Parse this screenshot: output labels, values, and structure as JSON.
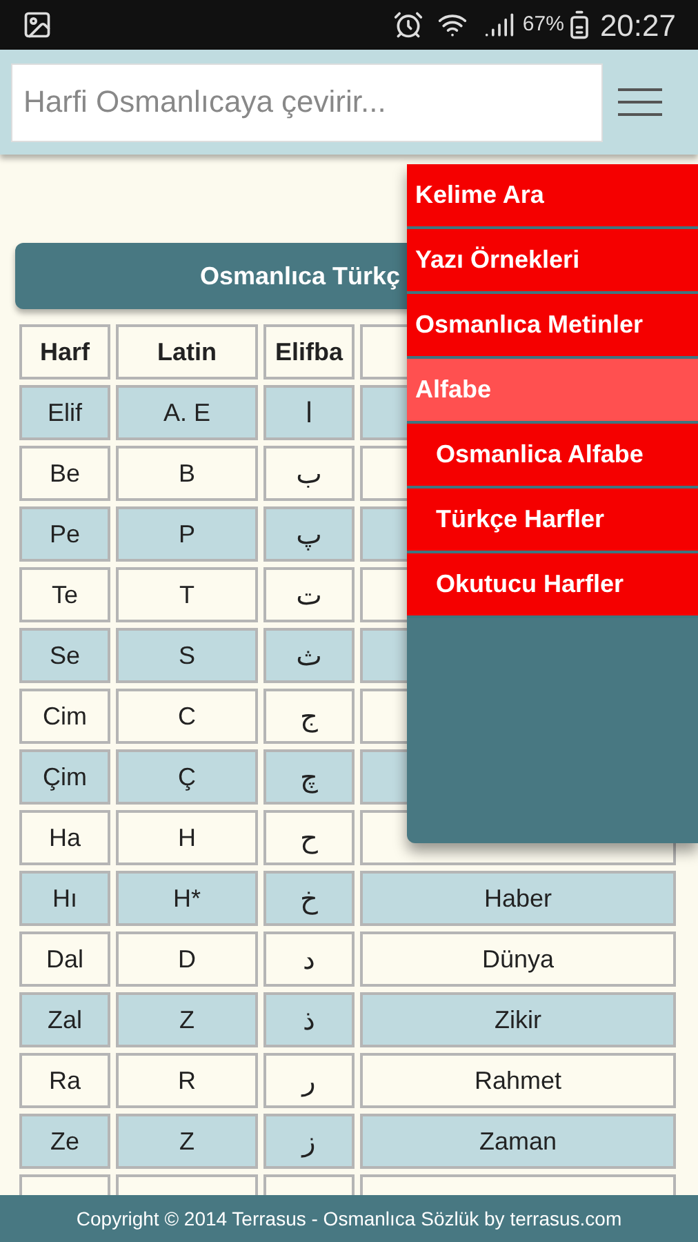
{
  "status_bar": {
    "battery": "67%",
    "time": "20:27"
  },
  "search": {
    "placeholder": "Harfi Osmanlıcaya çevirir..."
  },
  "title": "Osmanlıca Türkç",
  "table": {
    "columns": [
      "Harf",
      "Latin",
      "Elifba"
    ],
    "rows": [
      {
        "harf": "Elif",
        "latin": "A. E",
        "elifba": "ا"
      },
      {
        "harf": "Be",
        "latin": "B",
        "elifba": "ب"
      },
      {
        "harf": "Pe",
        "latin": "P",
        "elifba": "پ"
      },
      {
        "harf": "Te",
        "latin": "T",
        "elifba": "ت"
      },
      {
        "harf": "Se",
        "latin": "S",
        "elifba": "ث"
      },
      {
        "harf": "Cim",
        "latin": "C",
        "elifba": "ج"
      },
      {
        "harf": "Çim",
        "latin": "Ç",
        "elifba": "چ"
      },
      {
        "harf": "Ha",
        "latin": "H",
        "elifba": "ح"
      },
      {
        "harf": "Hı",
        "latin": "H*",
        "elifba": "خ",
        "example": "Haber"
      },
      {
        "harf": "Dal",
        "latin": "D",
        "elifba": "د",
        "example": "Dünya"
      },
      {
        "harf": "Zal",
        "latin": "Z",
        "elifba": "ذ",
        "example": "Zikir"
      },
      {
        "harf": "Ra",
        "latin": "R",
        "elifba": "ر",
        "example": "Rahmet"
      },
      {
        "harf": "Ze",
        "latin": "Z",
        "elifba": "ز",
        "example": "Zaman"
      }
    ]
  },
  "menu": {
    "items": [
      {
        "label": "Kelime Ara",
        "selected": false
      },
      {
        "label": "Yazı Örnekleri",
        "selected": false
      },
      {
        "label": "Osmanlıca Metinler",
        "selected": false
      },
      {
        "label": "Alfabe",
        "selected": true,
        "children": [
          {
            "label": "Osmanlica Alfabe",
            "selected": false
          },
          {
            "label": "Türkçe Harfler",
            "selected": false
          },
          {
            "label": "Okutucu Harfler",
            "selected": false
          }
        ]
      }
    ]
  },
  "footer": "Copyright © 2014 Terrasus - Osmanlıca Sözlük by terrasus.com"
}
